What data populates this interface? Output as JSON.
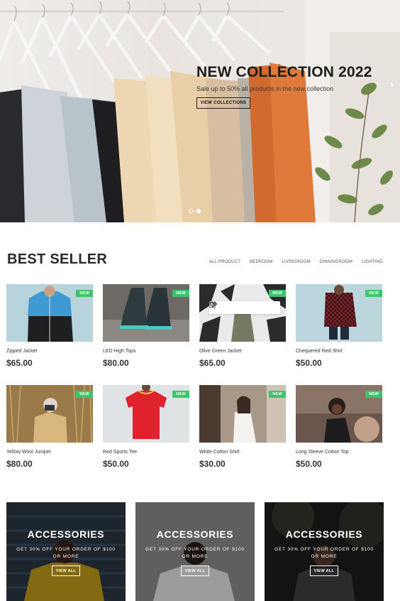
{
  "hero": {
    "title": "NEW COLLECTION 2022",
    "subtitle": "Sale up to 50% all products in the new collection",
    "button_label": "VIEW COLLECTIONS",
    "next_arrow": "›"
  },
  "best_seller": {
    "title": "BEST SELLER",
    "filters": [
      "ALL PRODUCT",
      "BEDROOM",
      "LIVINGROOM",
      "DINNINGROOM",
      "LIGHTING"
    ],
    "badge": "NEW",
    "products": [
      {
        "name": "Zipped Jacket",
        "price": "$65.00"
      },
      {
        "name": "LED High Tops",
        "price": "$80.00"
      },
      {
        "name": "Olive Green Jacket",
        "price": "$65.00"
      },
      {
        "name": "Chequered Red Shirt",
        "price": "$50.00"
      },
      {
        "name": "Yellow Wool Jumper",
        "price": "$80.00"
      },
      {
        "name": "Red Sports Tee",
        "price": "$50.00"
      },
      {
        "name": "White Cotton Shirt",
        "price": "$30.00"
      },
      {
        "name": "Long Sleeve Cotton Top",
        "price": "$50.00"
      }
    ]
  },
  "promos": [
    {
      "title": "ACCESSORIES",
      "text": "GET 30% OFF YOUR ORDER OF $100 OR MORE",
      "button": "VIEW ALL"
    },
    {
      "title": "ACCESSORIES",
      "text": "GET 30% OFF YOUR ORDER OF $100 OR MORE",
      "button": "VIEW ALL"
    },
    {
      "title": "ACCESSORIES",
      "text": "GET 30% OFF YOUR ORDER OF $100 OR MORE",
      "button": "VIEW ALL"
    }
  ],
  "colors": {
    "badge": "#3ec46d",
    "text": "#333333",
    "hero_bg": "#ece8e4"
  }
}
